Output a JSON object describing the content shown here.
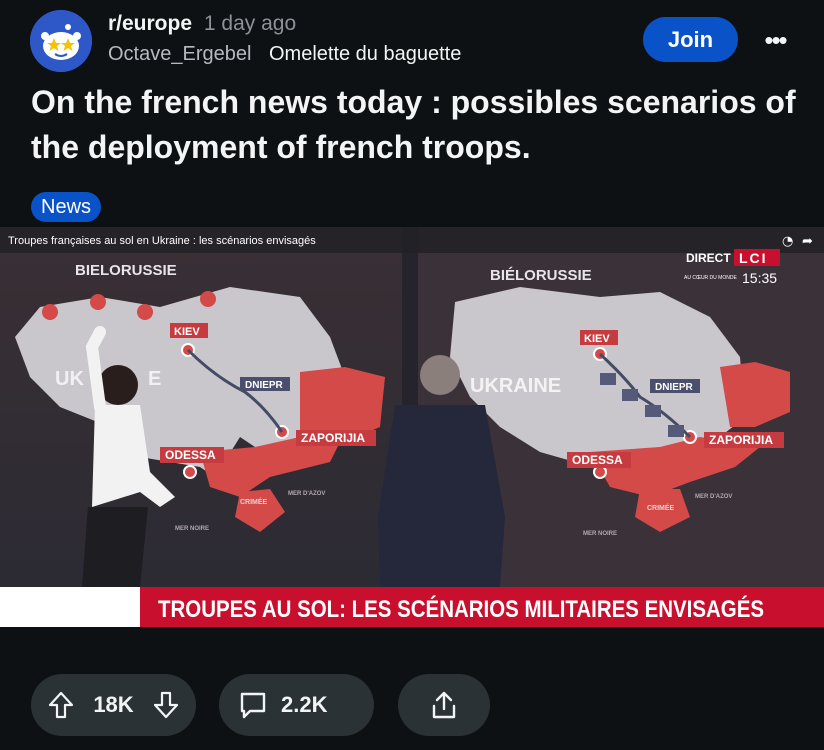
{
  "post": {
    "subreddit": "r/europe",
    "time_ago": "1 day ago",
    "author": "Octave_Ergebel",
    "user_flair": "Omelette du baguette",
    "title": "On the french news today : possibles scenarios of the deployment of french troops.",
    "post_flair": "News"
  },
  "buttons": {
    "join": "Join",
    "more": "•••"
  },
  "video": {
    "caption": "Troupes françaises au sol en Ukraine : les scénarios envisagés",
    "channel_live": "DIRECT",
    "channel_name": "LCI",
    "channel_sub": "AU CŒUR DU MONDE",
    "clock": "15:35",
    "banner": "TROUPES AU SOL: LES SCÉNARIOS MILITAIRES ENVISAGÉS",
    "map_labels": {
      "bielorussie": "BIELORUSSIE",
      "bielorussie_right": "BIÉLORUSSIE",
      "ukraine_left": "UK",
      "ukraine_left_tail": "E",
      "ukraine": "UKRAINE",
      "kiev": "KIEV",
      "dniepr": "DNIEPR",
      "zaporijia": "ZAPORIJIA",
      "odessa": "ODESSA",
      "crimee": "CRIMÉE",
      "mer_noire": "MER NOIRE",
      "mer_azov": "MER D'AZOV"
    }
  },
  "stats": {
    "votes": "18K",
    "comments": "2.2K"
  },
  "colors": {
    "background": "#0e1113",
    "accent": "#0a52c8",
    "pill": "#2a3236",
    "banner_red": "#c8102e"
  }
}
